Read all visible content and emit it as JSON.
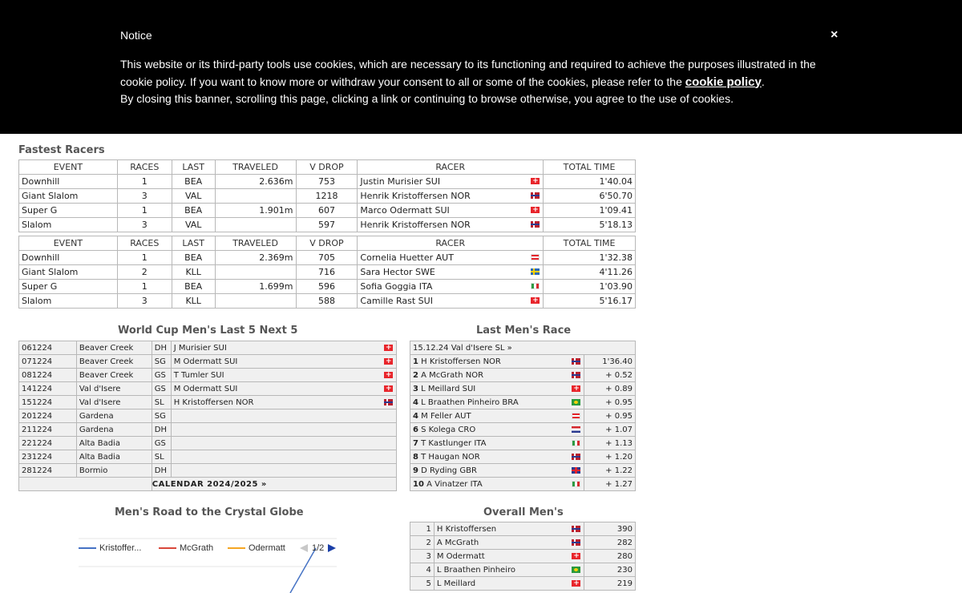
{
  "cookie": {
    "title": "Notice",
    "close": "×",
    "text1": "This website or its third-party tools use cookies, which are necessary to its functioning and required to achieve the purposes illustrated in the cookie policy. If you want to know more or withdraw your consent to all or some of the cookies, please refer to the ",
    "link": "cookie policy",
    "text2": ".",
    "text3": "By closing this banner, scrolling this page, clicking a link or continuing to browse otherwise, you agree to the use of cookies."
  },
  "fastest": {
    "title": "Fastest Racers",
    "headers": [
      "EVENT",
      "RACES",
      "LAST",
      "TRAVELED",
      "V DROP",
      "RACER",
      "TOTAL TIME"
    ],
    "men": [
      {
        "event": "Downhill",
        "races": "1",
        "last": "BEA",
        "traveled": "2.636m",
        "vdrop": "753",
        "racer": "Justin Murisier SUI",
        "flag": "sui",
        "time": "1'40.04"
      },
      {
        "event": "Giant Slalom",
        "races": "3",
        "last": "VAL",
        "traveled": "",
        "vdrop": "1218",
        "racer": "Henrik Kristoffersen NOR",
        "flag": "nor",
        "time": "6'50.70"
      },
      {
        "event": "Super G",
        "races": "1",
        "last": "BEA",
        "traveled": "1.901m",
        "vdrop": "607",
        "racer": "Marco Odermatt SUI",
        "flag": "sui",
        "time": "1'09.41"
      },
      {
        "event": "Slalom",
        "races": "3",
        "last": "VAL",
        "traveled": "",
        "vdrop": "597",
        "racer": "Henrik Kristoffersen NOR",
        "flag": "nor",
        "time": "5'18.13"
      }
    ],
    "women": [
      {
        "event": "Downhill",
        "races": "1",
        "last": "BEA",
        "traveled": "2.369m",
        "vdrop": "705",
        "racer": "Cornelia Huetter AUT",
        "flag": "aut",
        "time": "1'32.38"
      },
      {
        "event": "Giant Slalom",
        "races": "2",
        "last": "KLL",
        "traveled": "",
        "vdrop": "716",
        "racer": "Sara Hector SWE",
        "flag": "swe",
        "time": "4'11.26"
      },
      {
        "event": "Super G",
        "races": "1",
        "last": "BEA",
        "traveled": "1.699m",
        "vdrop": "596",
        "racer": "Sofia Goggia ITA",
        "flag": "ita",
        "time": "1'03.90"
      },
      {
        "event": "Slalom",
        "races": "3",
        "last": "KLL",
        "traveled": "",
        "vdrop": "588",
        "racer": "Camille Rast SUI",
        "flag": "sui",
        "time": "5'16.17"
      }
    ]
  },
  "worldcup": {
    "title": "World Cup Men's Last 5 Next 5",
    "rows": [
      {
        "date": "061224",
        "place": "Beaver Creek",
        "disc": "DH",
        "winner": "J Murisier SUI",
        "flag": "sui"
      },
      {
        "date": "071224",
        "place": "Beaver Creek",
        "disc": "SG",
        "winner": "M Odermatt SUI",
        "flag": "sui"
      },
      {
        "date": "081224",
        "place": "Beaver Creek",
        "disc": "GS",
        "winner": "T Tumler SUI",
        "flag": "sui"
      },
      {
        "date": "141224",
        "place": "Val d'Isere",
        "disc": "GS",
        "winner": "M Odermatt SUI",
        "flag": "sui"
      },
      {
        "date": "151224",
        "place": "Val d'Isere",
        "disc": "SL",
        "winner": "H Kristoffersen NOR",
        "flag": "nor"
      },
      {
        "date": "201224",
        "place": "Gardena",
        "disc": "SG",
        "winner": "",
        "flag": ""
      },
      {
        "date": "211224",
        "place": "Gardena",
        "disc": "DH",
        "winner": "",
        "flag": ""
      },
      {
        "date": "221224",
        "place": "Alta Badia",
        "disc": "GS",
        "winner": "",
        "flag": ""
      },
      {
        "date": "231224",
        "place": "Alta Badia",
        "disc": "SL",
        "winner": "",
        "flag": ""
      },
      {
        "date": "281224",
        "place": "Bormio",
        "disc": "DH",
        "winner": "",
        "flag": ""
      }
    ],
    "calendar": "CALENDAR 2024/2025 »"
  },
  "lastrace": {
    "title": "Last Men's Race",
    "header": "15.12.24 Val d'Isere SL »",
    "rows": [
      {
        "pos": "1",
        "name": "H Kristoffersen NOR",
        "flag": "nor",
        "time": "1'36.40"
      },
      {
        "pos": "2",
        "name": "A McGrath NOR",
        "flag": "nor",
        "time": "+ 0.52"
      },
      {
        "pos": "3",
        "name": "L Meillard SUI",
        "flag": "sui",
        "time": "+ 0.89"
      },
      {
        "pos": "4",
        "name": "L Braathen Pinheiro BRA",
        "flag": "bra",
        "time": "+ 0.95"
      },
      {
        "pos": "4",
        "name": "M Feller AUT",
        "flag": "aut",
        "time": "+ 0.95"
      },
      {
        "pos": "6",
        "name": "S Kolega CRO",
        "flag": "cro",
        "time": "+ 1.07"
      },
      {
        "pos": "7",
        "name": "T Kastlunger ITA",
        "flag": "ita",
        "time": "+ 1.13"
      },
      {
        "pos": "8",
        "name": "T Haugan NOR",
        "flag": "nor",
        "time": "+ 1.20"
      },
      {
        "pos": "9",
        "name": "D Ryding GBR",
        "flag": "gbr",
        "time": "+ 1.22"
      },
      {
        "pos": "10",
        "name": "A Vinatzer ITA",
        "flag": "ita",
        "time": "+ 1.27"
      }
    ]
  },
  "globe": {
    "title": "Men's Road to the Crystal Globe",
    "legend": [
      {
        "name": "Kristoffer...",
        "color": "#4572c4"
      },
      {
        "name": "McGrath",
        "color": "#d9473a"
      },
      {
        "name": "Odermatt",
        "color": "#f5a623"
      }
    ],
    "page": "1/2"
  },
  "overall": {
    "title": "Overall Men's",
    "rows": [
      {
        "pos": "1",
        "name": "H Kristoffersen",
        "flag": "nor",
        "points": "390"
      },
      {
        "pos": "2",
        "name": "A McGrath",
        "flag": "nor",
        "points": "282"
      },
      {
        "pos": "3",
        "name": "M Odermatt",
        "flag": "sui",
        "points": "280"
      },
      {
        "pos": "4",
        "name": "L Braathen Pinheiro",
        "flag": "bra",
        "points": "230"
      },
      {
        "pos": "5",
        "name": "L Meillard",
        "flag": "sui",
        "points": "219"
      }
    ]
  }
}
